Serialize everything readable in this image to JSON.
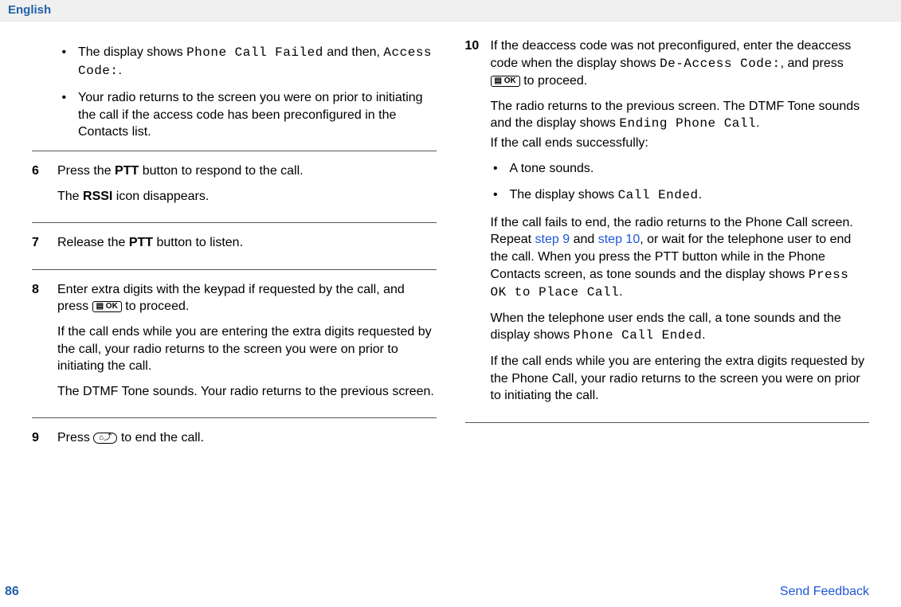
{
  "header": {
    "language": "English"
  },
  "left": {
    "bullets": {
      "b1_pre": "The display shows ",
      "b1_mono1": "Phone Call Failed",
      "b1_mid": " and then, ",
      "b1_mono2": "Access Code:",
      "b1_post": ".",
      "b2": "Your radio returns to the screen you were on prior to initiating the call if the access code has been preconfigured in the Contacts list."
    },
    "step6": {
      "num": "6",
      "l1a": "Press the ",
      "l1b": "PTT",
      "l1c": " button to respond to the call.",
      "l2a": "The ",
      "l2b": "RSSI",
      "l2c": " icon disappears."
    },
    "step7": {
      "num": "7",
      "l1a": "Release the ",
      "l1b": "PTT",
      "l1c": " button to listen."
    },
    "step8": {
      "num": "8",
      "l1": "Enter extra digits with the keypad if requested by the call, and press ",
      "l1_post": " to proceed.",
      "l2": "If the call ends while you are entering the extra digits requested by the call, your radio returns to the screen you were on prior to initiating the call.",
      "l3": "The DTMF Tone sounds. Your radio returns to the previous screen."
    },
    "step9": {
      "num": "9",
      "l1a": "Press ",
      "l1b": " to end the call."
    }
  },
  "right": {
    "step10": {
      "num": "10",
      "p1a": "If the deaccess code was not preconfigured, enter the deaccess code when the display shows ",
      "p1_mono": "De-Access Code:",
      "p1b": ", and press ",
      "p1c": " to proceed.",
      "p2a": "The radio returns to the previous screen. The DTMF Tone sounds and the display shows ",
      "p2_mono": "Ending Phone Call",
      "p2b": ".",
      "p3": "If the call ends successfully:",
      "bullets": {
        "b1": "A tone sounds.",
        "b2a": "The display shows ",
        "b2_mono": "Call Ended",
        "b2b": "."
      },
      "p4a": "If the call fails to end, the radio returns to the Phone Call screen. Repeat ",
      "p4_link1": "step 9",
      "p4b": " and ",
      "p4_link2": "step 10",
      "p4c": ", or wait for the telephone user to end the call. When you press the PTT button while in the Phone Contacts screen, as tone sounds and the display shows ",
      "p4_mono": "Press OK to Place Call",
      "p4d": ".",
      "p5a": "When the telephone user ends the call, a tone sounds and the display shows ",
      "p5_mono": "Phone Call Ended",
      "p5b": ".",
      "p6": "If the call ends while you are entering the extra digits requested by the Phone Call, your radio returns to the screen you were on prior to initiating the call."
    }
  },
  "footer": {
    "page": "86",
    "feedback": "Send Feedback"
  },
  "icons": {
    "ok": "▤ OK",
    "home": "⌂⤴"
  }
}
